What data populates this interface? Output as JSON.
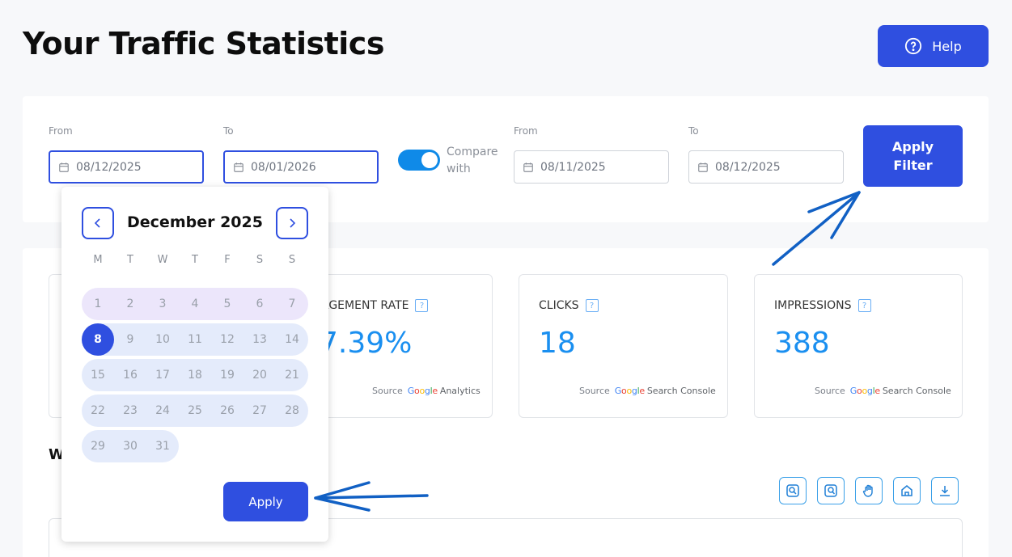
{
  "header": {
    "title": "Your Traffic Statistics",
    "help_label": "Help"
  },
  "filters": {
    "from_label": "From",
    "to_label": "To",
    "from_value": "08/12/2025",
    "to_value": "08/01/2026",
    "compare_label": "Compare with",
    "compare_enabled": true,
    "compare_from_label": "From",
    "compare_to_label": "To",
    "compare_from_value": "08/11/2025",
    "compare_to_value": "08/12/2025",
    "apply_filter_label": "Apply Filter"
  },
  "calendar": {
    "month_label": "December 2025",
    "weekdays": [
      "M",
      "T",
      "W",
      "T",
      "F",
      "S",
      "S"
    ],
    "weeks": [
      [
        "1",
        "2",
        "3",
        "4",
        "5",
        "6",
        "7"
      ],
      [
        "8",
        "9",
        "10",
        "11",
        "12",
        "13",
        "14"
      ],
      [
        "15",
        "16",
        "17",
        "18",
        "19",
        "20",
        "21"
      ],
      [
        "22",
        "23",
        "24",
        "25",
        "26",
        "27",
        "28"
      ],
      [
        "29",
        "30",
        "31"
      ]
    ],
    "selected_day": "8",
    "apply_label": "Apply"
  },
  "stats": {
    "cards": [
      {
        "title": "AGEMENT RATE",
        "value": "7.39%",
        "source_label": "Source",
        "source_brand": "Google",
        "source_product": "Analytics"
      },
      {
        "title": "CLICKS",
        "value": "18",
        "source_label": "Source",
        "source_brand": "Google",
        "source_product": "Search Console"
      },
      {
        "title": "IMPRESSIONS",
        "value": "388",
        "source_label": "Source",
        "source_brand": "Google",
        "source_product": "Search Console"
      }
    ],
    "help_badge": "?"
  },
  "section": {
    "heading": "W"
  },
  "chart_toolbar": {
    "tools": [
      "zoom-in-icon",
      "zoom-out-icon",
      "pan-icon",
      "home-icon",
      "download-icon"
    ]
  },
  "colors": {
    "primary": "#2f4fe0",
    "accent": "#1a8ff0",
    "toggle_on": "#0f8ae8",
    "week_band_first": "#ece6fb",
    "week_band": "#e4ebfb"
  }
}
